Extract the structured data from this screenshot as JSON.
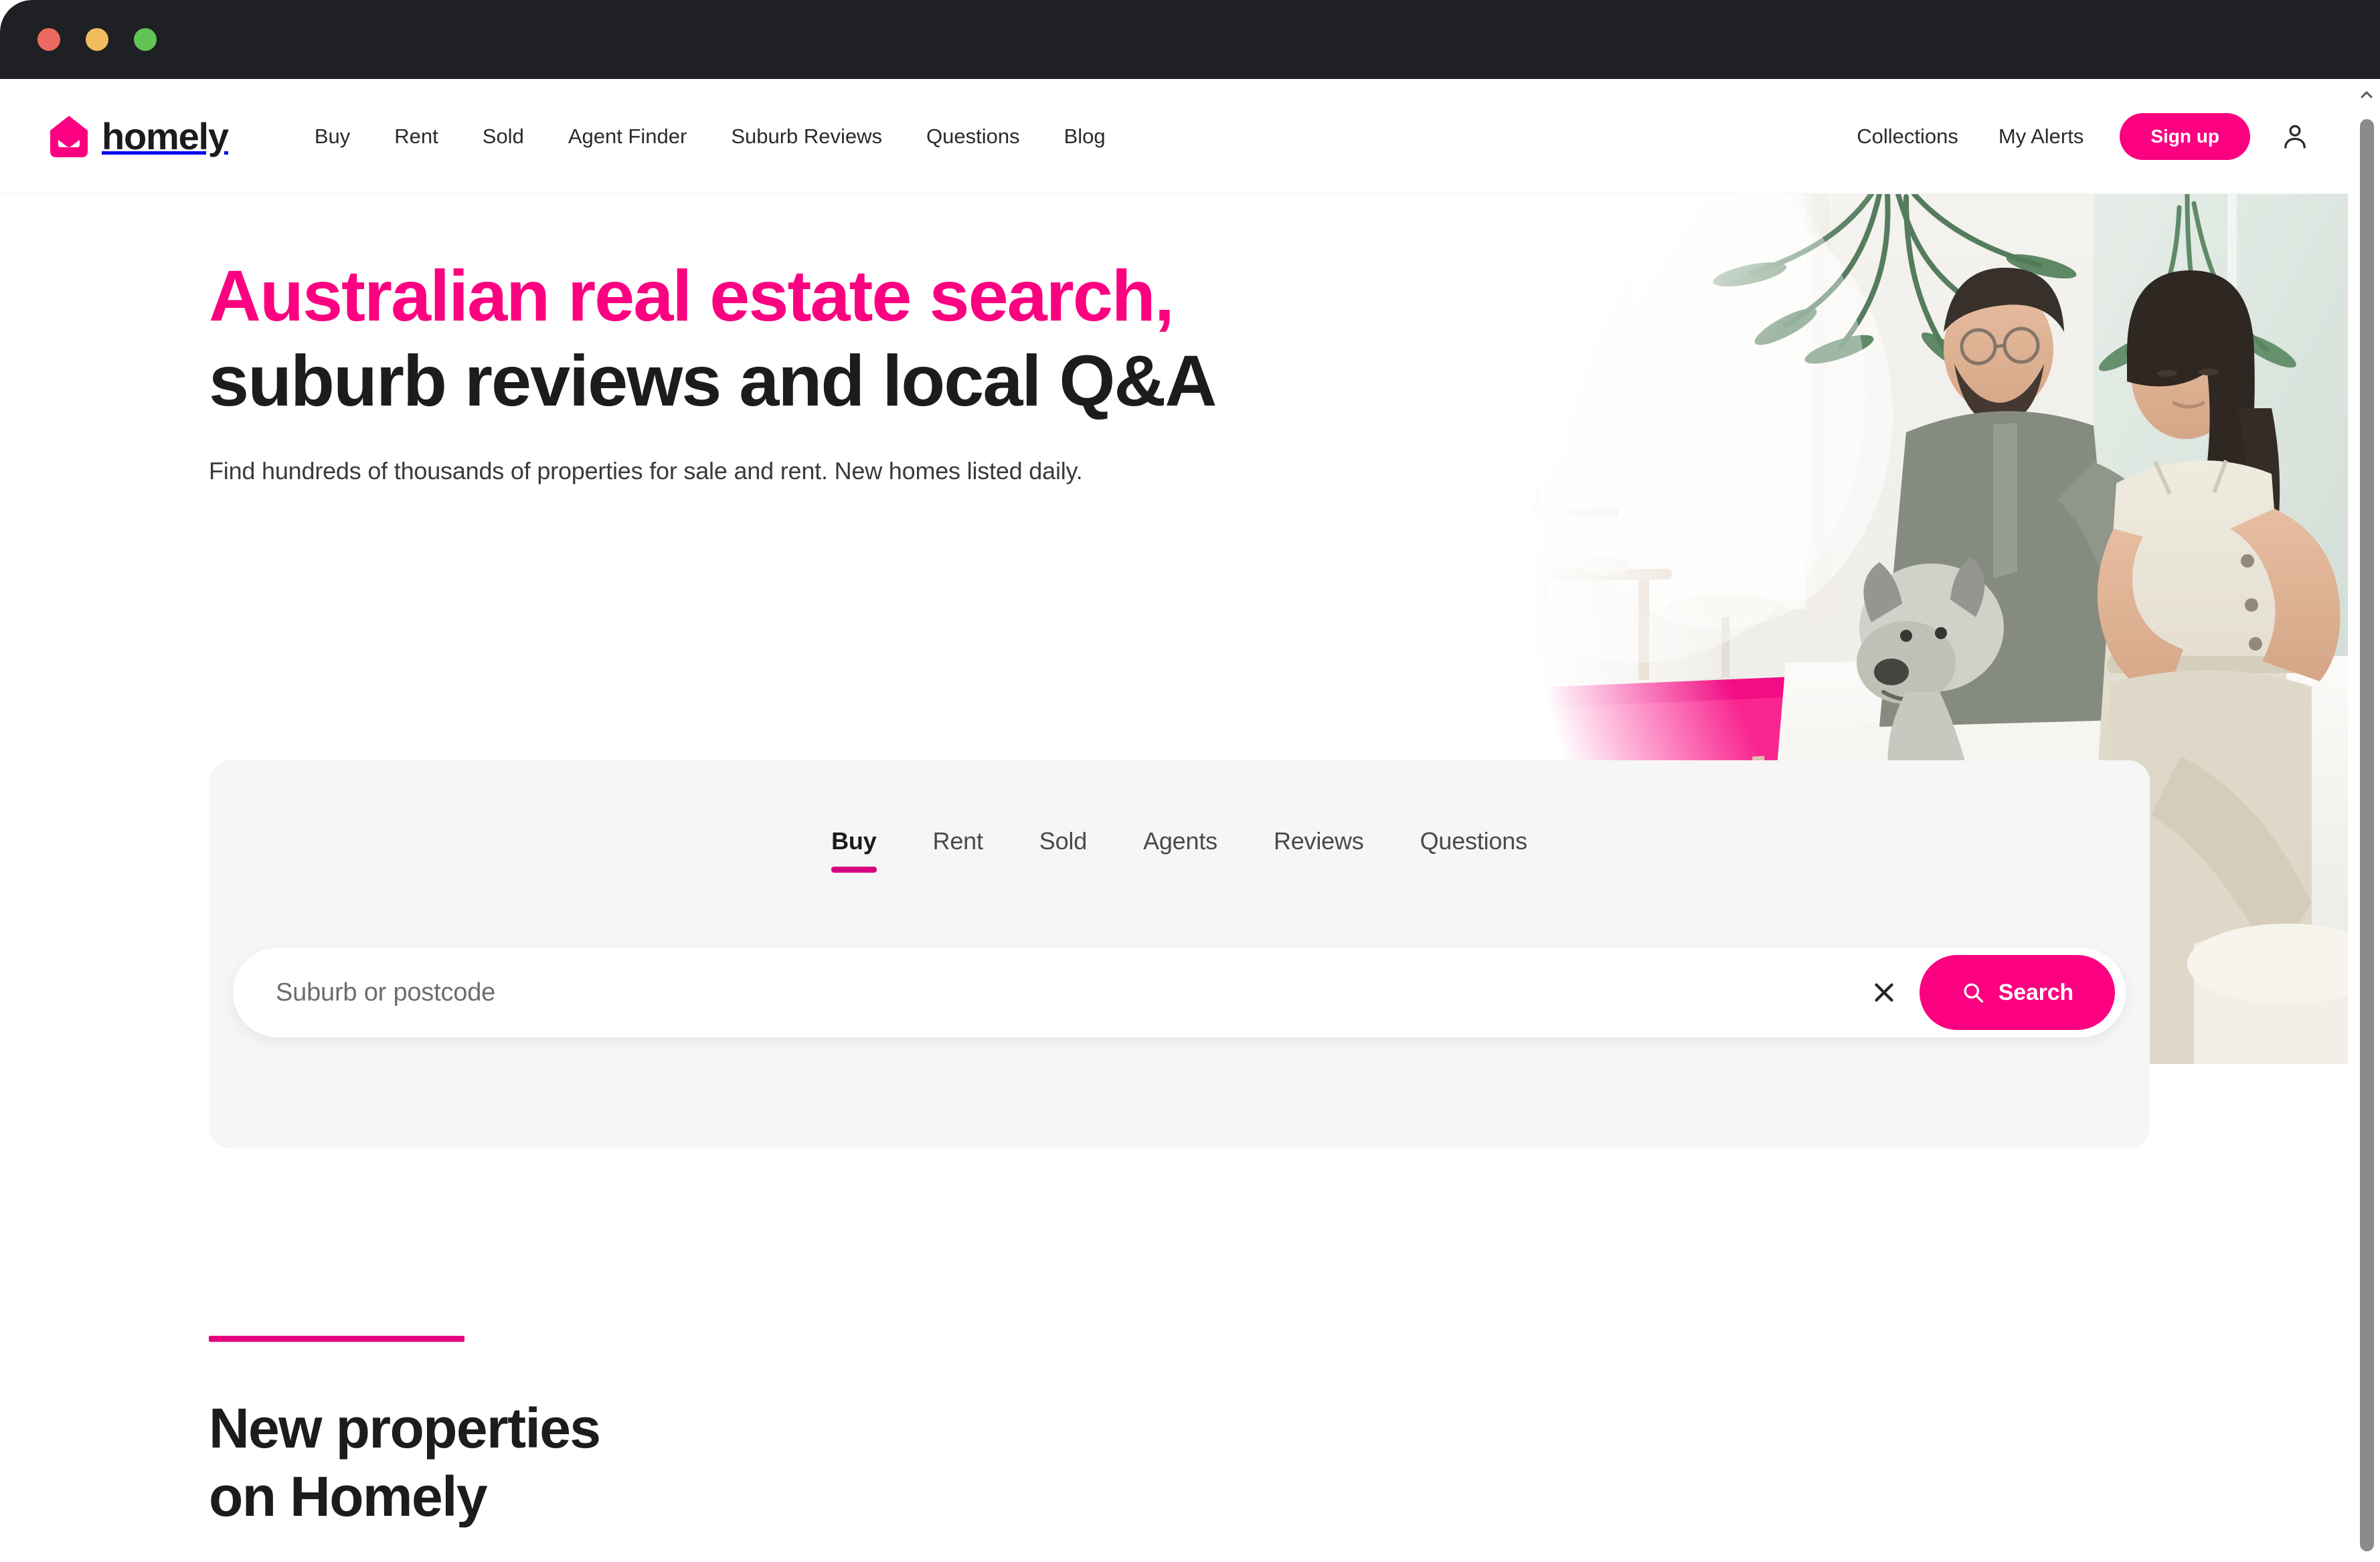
{
  "window": {
    "traffic_lights": [
      {
        "name": "close",
        "color": "#ec6a5f"
      },
      {
        "name": "minimize",
        "color": "#f0bc5e"
      },
      {
        "name": "maximize",
        "color": "#61c454"
      }
    ],
    "titlebar_color": "#1f2023"
  },
  "theme": {
    "accent_pink": "#fb0080",
    "accent_pink_dark": "#d5007f",
    "text_dark": "#1c1c1c",
    "card_bg": "#f6f6f6"
  },
  "header": {
    "brand": {
      "logo_icon": "homely-house-envelope-icon",
      "wordmark": "homely"
    },
    "nav": [
      {
        "label": "Buy"
      },
      {
        "label": "Rent"
      },
      {
        "label": "Sold"
      },
      {
        "label": "Agent Finder"
      },
      {
        "label": "Suburb Reviews"
      },
      {
        "label": "Questions"
      },
      {
        "label": "Blog"
      }
    ],
    "right": {
      "collections_label": "Collections",
      "alerts_label": "My Alerts",
      "signup_label": "Sign up",
      "account_icon": "user-account-icon"
    }
  },
  "hero": {
    "headline_line1": "Australian real estate search,",
    "headline_line2": "suburb reviews and local Q&A",
    "subhead": "Find hundreds of thousands of properties for sale and rent. New homes listed daily.",
    "photo_alt": "couple-with-dog-on-sofa-photo"
  },
  "search": {
    "tabs": [
      {
        "label": "Buy",
        "active": true
      },
      {
        "label": "Rent",
        "active": false
      },
      {
        "label": "Sold",
        "active": false
      },
      {
        "label": "Agents",
        "active": false
      },
      {
        "label": "Reviews",
        "active": false
      },
      {
        "label": "Questions",
        "active": false
      }
    ],
    "input_value": "",
    "placeholder": "Suburb or postcode",
    "clear_icon": "close-x-icon",
    "search_icon": "magnifier-icon",
    "search_label": "Search"
  },
  "section": {
    "title_line1": "New properties",
    "title_line2": "on Homely"
  },
  "scrollbar": {
    "up_arrow_icon": "chevron-up-icon",
    "thumb_name": "vertical-scroll-thumb"
  }
}
